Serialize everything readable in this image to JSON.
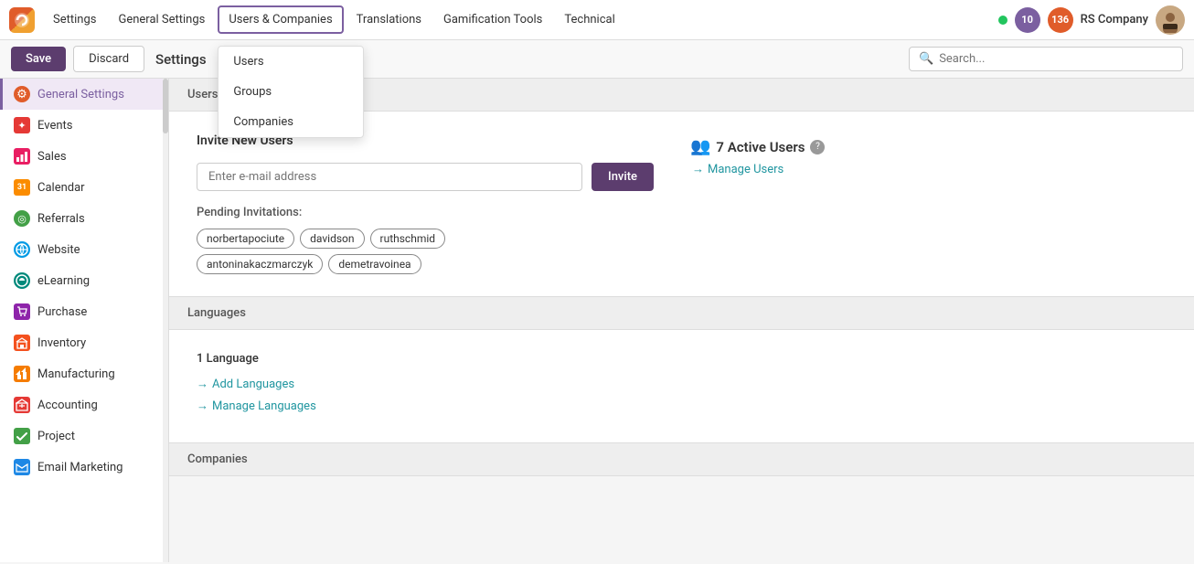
{
  "nav": {
    "logo_text": "O",
    "items": [
      {
        "label": "Settings",
        "id": "settings",
        "active": false
      },
      {
        "label": "General Settings",
        "id": "general-settings",
        "active": false
      },
      {
        "label": "Users & Companies",
        "id": "users-companies",
        "active": true
      },
      {
        "label": "Translations",
        "id": "translations",
        "active": false
      },
      {
        "label": "Gamification Tools",
        "id": "gamification",
        "active": false
      },
      {
        "label": "Technical",
        "id": "technical",
        "active": false
      }
    ],
    "dropdown": {
      "items": [
        {
          "label": "Users",
          "id": "users"
        },
        {
          "label": "Groups",
          "id": "groups"
        },
        {
          "label": "Companies",
          "id": "companies"
        }
      ]
    },
    "right": {
      "messages_count": "10",
      "activity_count": "136",
      "company_name": "RS Company"
    }
  },
  "toolbar": {
    "save_label": "Save",
    "discard_label": "Discard",
    "title": "Settings",
    "search_placeholder": "Search..."
  },
  "sidebar": {
    "items": [
      {
        "label": "General Settings",
        "id": "general-settings",
        "active": true,
        "icon": "⚙"
      },
      {
        "label": "Events",
        "id": "events",
        "active": false,
        "icon": "✦"
      },
      {
        "label": "Sales",
        "id": "sales",
        "active": false,
        "icon": "📊"
      },
      {
        "label": "Calendar",
        "id": "calendar",
        "active": false,
        "icon": "31"
      },
      {
        "label": "Referrals",
        "id": "referrals",
        "active": false,
        "icon": "◎"
      },
      {
        "label": "Website",
        "id": "website",
        "active": false,
        "icon": "🌐"
      },
      {
        "label": "eLearning",
        "id": "elearning",
        "active": false,
        "icon": "◑"
      },
      {
        "label": "Purchase",
        "id": "purchase",
        "active": false,
        "icon": "🛒"
      },
      {
        "label": "Inventory",
        "id": "inventory",
        "active": false,
        "icon": "📦"
      },
      {
        "label": "Manufacturing",
        "id": "manufacturing",
        "active": false,
        "icon": "🏭"
      },
      {
        "label": "Accounting",
        "id": "accounting",
        "active": false,
        "icon": "💹"
      },
      {
        "label": "Project",
        "id": "project",
        "active": false,
        "icon": "✔"
      },
      {
        "label": "Email Marketing",
        "id": "email-marketing",
        "active": false,
        "icon": "✉"
      }
    ]
  },
  "main": {
    "sections": [
      {
        "id": "users",
        "header": "Users",
        "invite": {
          "title": "Invite New Users",
          "email_placeholder": "Enter e-mail address",
          "invite_button": "Invite",
          "pending_label": "Pending Invitations:",
          "tags": [
            "norbertapociute",
            "davidson",
            "ruthschmid",
            "antoninakaczmarczyk",
            "demetravoinea"
          ]
        },
        "active_users": {
          "count": "7 Active Users",
          "manage_label": "Manage Users"
        }
      },
      {
        "id": "languages",
        "header": "Languages",
        "lang_count": "1 Language",
        "add_label": "Add Languages",
        "manage_label": "Manage Languages"
      },
      {
        "id": "companies",
        "header": "Companies"
      }
    ]
  }
}
